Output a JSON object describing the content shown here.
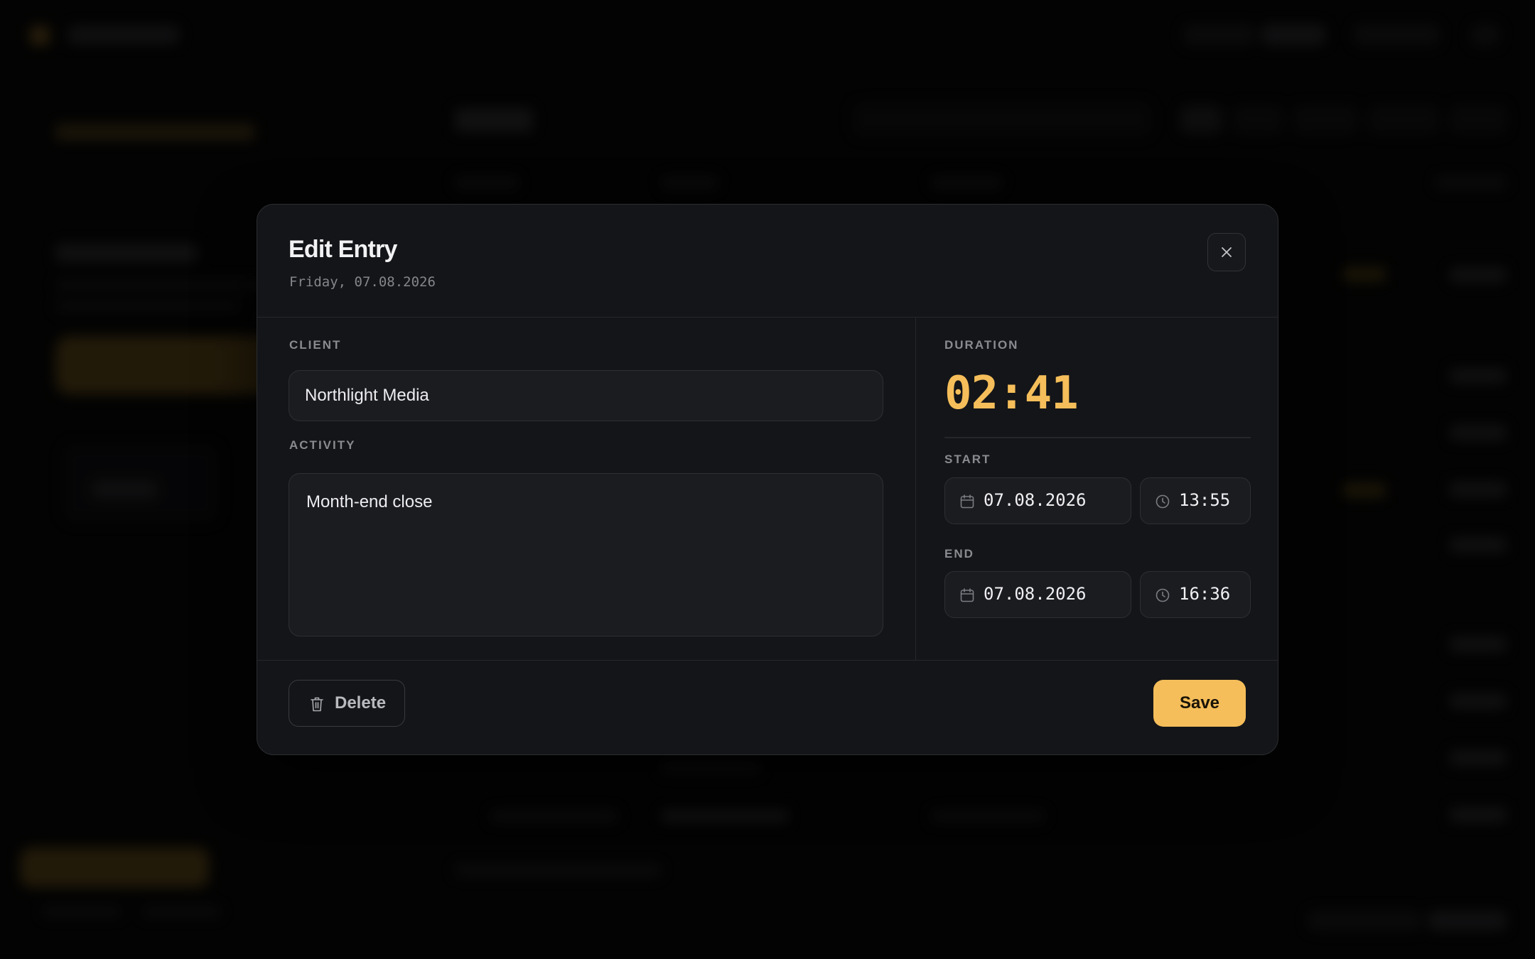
{
  "modal": {
    "title": "Edit Entry",
    "subtitle": "Friday, 07.08.2026",
    "close_icon": "close-icon"
  },
  "client": {
    "label": "CLIENT",
    "value": "Northlight Media"
  },
  "activity": {
    "label": "ACTIVITY",
    "value": "Month-end close"
  },
  "duration": {
    "label": "DURATION",
    "value": "02:41"
  },
  "start": {
    "label": "START",
    "date": "07.08.2026",
    "time": "13:55"
  },
  "end": {
    "label": "END",
    "date": "07.08.2026",
    "time": "16:36"
  },
  "footer": {
    "delete_label": "Delete",
    "save_label": "Save"
  },
  "colors": {
    "accent": "#f5be5a",
    "modal_bg": "#141518",
    "input_bg": "#1b1c20",
    "page_bg": "#050505"
  }
}
